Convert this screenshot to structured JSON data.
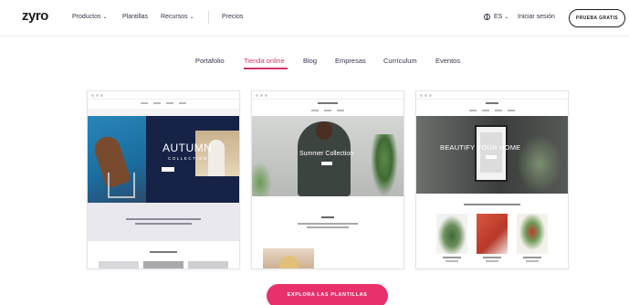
{
  "brand": {
    "logo": "zyro",
    "accent": "#e8316b",
    "active_tab_color": "#d6326e"
  },
  "nav": {
    "items": [
      {
        "label": "Productos",
        "dropdown": true
      },
      {
        "label": "Plantillas",
        "dropdown": false
      },
      {
        "label": "Recursos",
        "dropdown": true
      },
      {
        "label": "Precios",
        "dropdown": false
      }
    ],
    "language": {
      "icon": "globe-icon",
      "label": "ES"
    },
    "login": "Iniciar sesión",
    "cta": "PRUEBA GRATIS"
  },
  "tabs": [
    {
      "label": "Portafolio",
      "active": false
    },
    {
      "label": "Tienda online",
      "active": true
    },
    {
      "label": "Blog",
      "active": false
    },
    {
      "label": "Empresas",
      "active": false
    },
    {
      "label": "Currículum",
      "active": false
    },
    {
      "label": "Eventos",
      "active": false
    }
  ],
  "templates": [
    {
      "headline": "AUTUMN",
      "subline": "COLLECTION"
    },
    {
      "headline": "Summer Collection"
    },
    {
      "headline": "BEAUTIFY YOUR HOME"
    }
  ],
  "main_cta": "EXPLORA LAS PLANTILLAS"
}
